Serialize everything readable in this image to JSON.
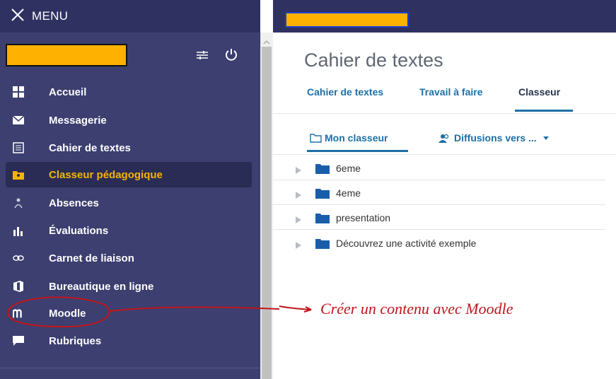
{
  "menu": {
    "label": "MENU",
    "icon": "close-icon"
  },
  "sidebar": {
    "items": [
      {
        "label": "Accueil",
        "icon": "grid-icon",
        "active": false
      },
      {
        "label": "Messagerie",
        "icon": "mail-icon",
        "active": false
      },
      {
        "label": "Cahier de textes",
        "icon": "notebook-icon",
        "active": false
      },
      {
        "label": "Classeur pédagogique",
        "icon": "folder-shared-icon",
        "active": true
      },
      {
        "label": "Absences",
        "icon": "absences-icon",
        "active": false
      },
      {
        "label": "Évaluations",
        "icon": "bar-chart-icon",
        "active": false
      },
      {
        "label": "Carnet de liaison",
        "icon": "link-icon",
        "active": false
      },
      {
        "label": "Bureautique en ligne",
        "icon": "office-icon",
        "active": false
      },
      {
        "label": "Moodle",
        "icon": "moodle-icon",
        "active": false
      },
      {
        "label": "Rubriques",
        "icon": "chat-icon",
        "active": false
      }
    ]
  },
  "main": {
    "title": "Cahier de textes",
    "tabs": [
      {
        "label": "Cahier de textes",
        "active": false
      },
      {
        "label": "Travail à faire",
        "active": false
      },
      {
        "label": "Classeur",
        "active": true
      }
    ],
    "subtabs": [
      {
        "label": "Mon classeur",
        "icon": "folder-outline-icon",
        "active": true
      },
      {
        "label": "Diffusions vers ...",
        "icon": "users-icon",
        "dropdown": true
      }
    ],
    "folders": [
      {
        "label": "6eme"
      },
      {
        "label": "4eme"
      },
      {
        "label": "presentation"
      },
      {
        "label": "Découvrez une activité exemple"
      }
    ]
  },
  "annotation": {
    "text": "Créer un contenu avec Moodle",
    "color": "#c0161b"
  },
  "colors": {
    "sidebar": "#3c3f6f",
    "topbar": "#2f3261",
    "accent": "#1d6fa5",
    "highlight": "#f5b400",
    "redacted": "#ffb100"
  }
}
